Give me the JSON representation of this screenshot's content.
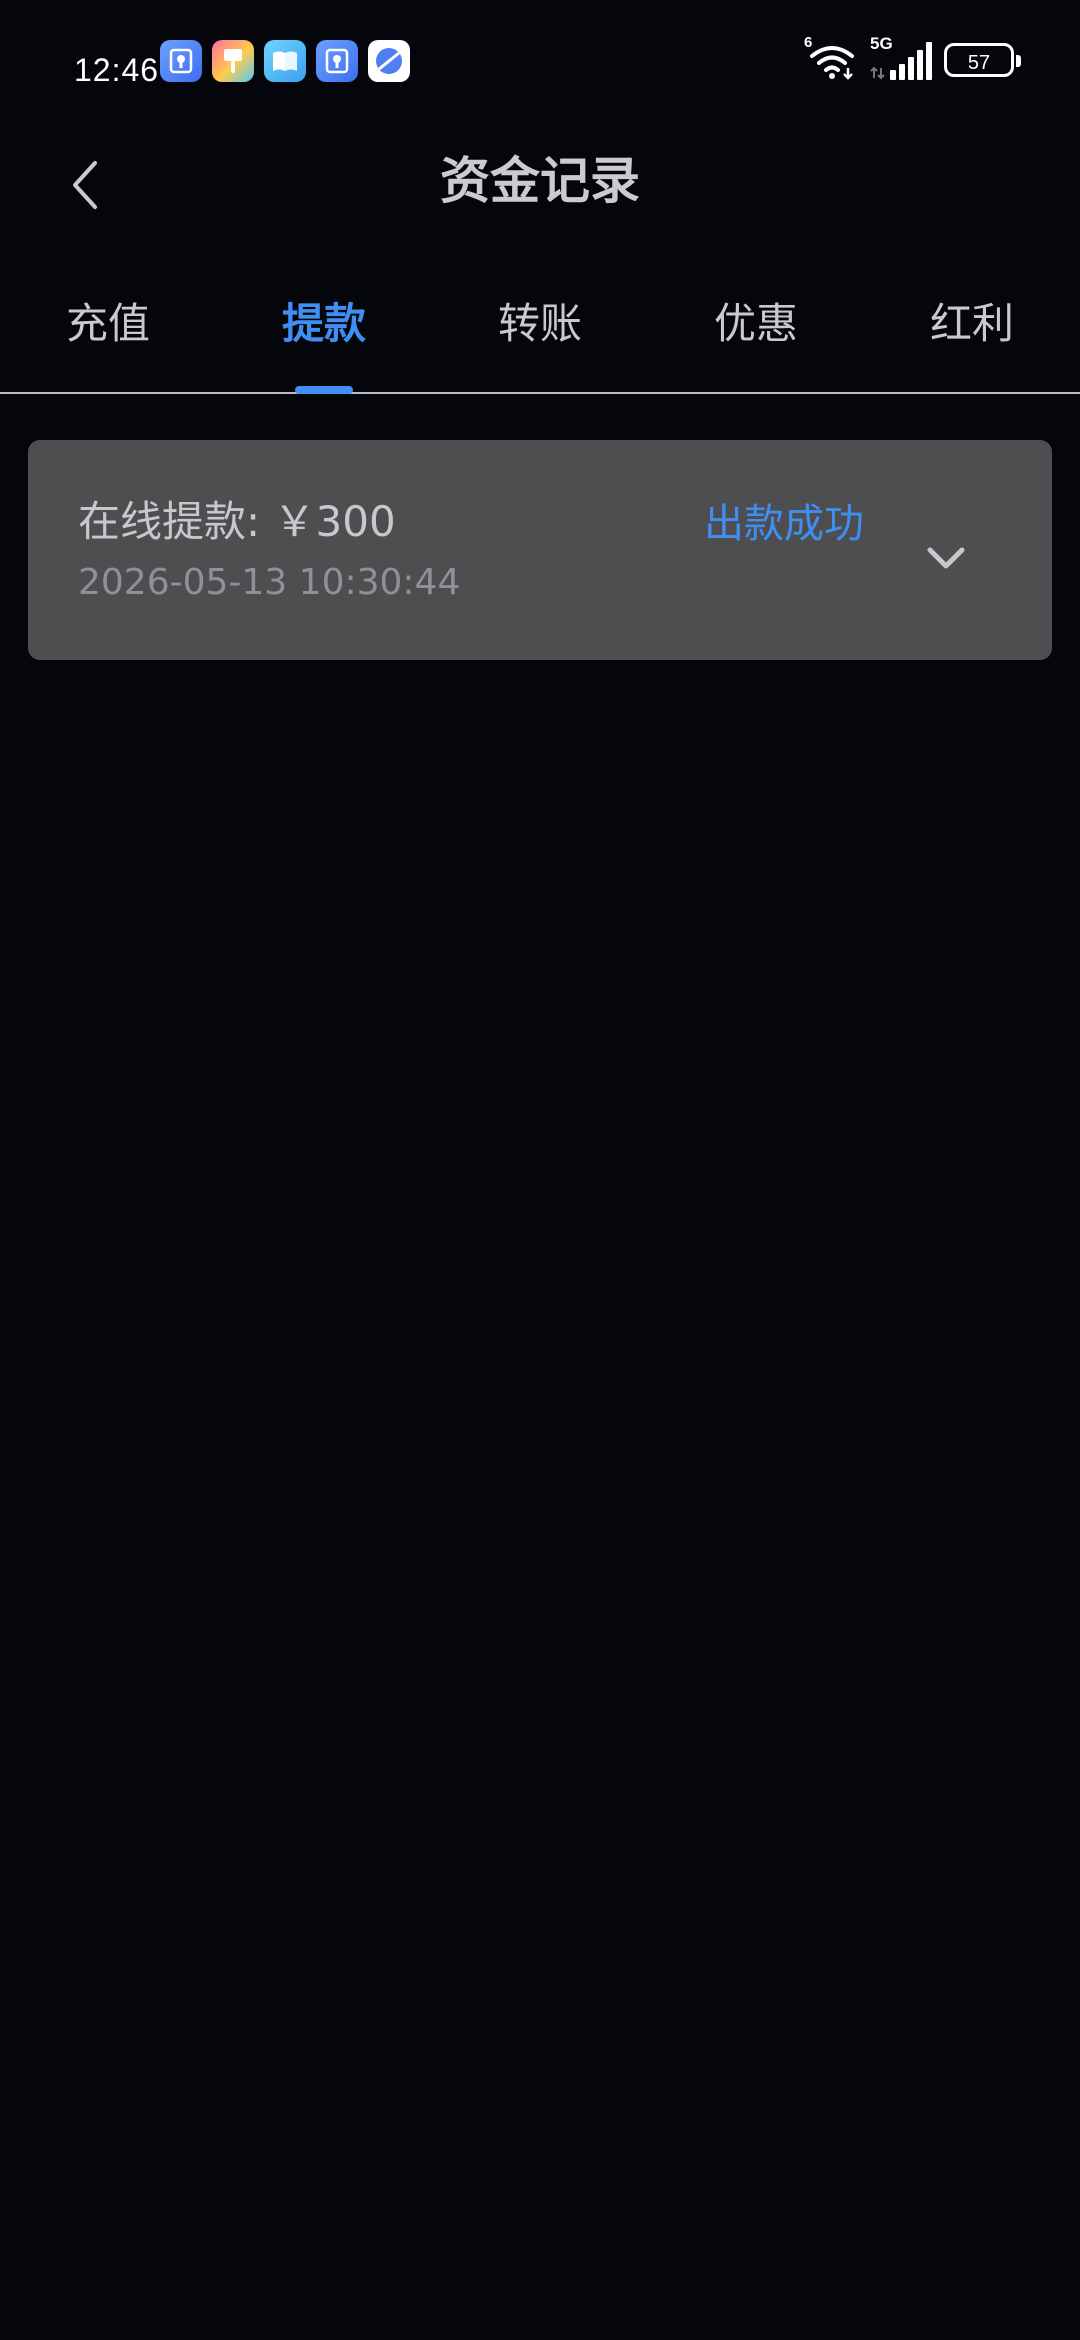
{
  "status_bar": {
    "time": "12:46",
    "notification_icons": [
      "security-app-icon",
      "paint-app-icon",
      "book-app-icon",
      "security-app-icon",
      "browser-app-icon"
    ],
    "wifi_badge": "6",
    "network_type": "5G",
    "battery_level": "57"
  },
  "header": {
    "title": "资金记录"
  },
  "tabs": [
    {
      "label": "充值",
      "active": false
    },
    {
      "label": "提款",
      "active": true
    },
    {
      "label": "转账",
      "active": false
    },
    {
      "label": "优惠",
      "active": false
    },
    {
      "label": "红利",
      "active": false
    }
  ],
  "records": [
    {
      "title": "在线提款: ￥300",
      "time": "2026-05-13 10:30:44",
      "status": "出款成功"
    }
  ],
  "colors": {
    "background": "#05060b",
    "accent": "#3f8ff2",
    "card": "#4e4e50",
    "text": "#c8cad0",
    "muted_text": "#8f9196"
  }
}
